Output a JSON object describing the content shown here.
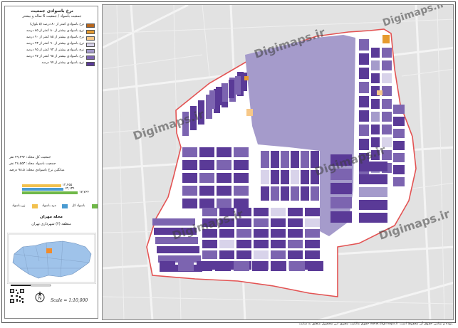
{
  "legend": {
    "title_line1": "نرخ باسوادی جمعیت",
    "title_line2": "جمعیت باسواد / جمعیت 6 ساله و بیشتر",
    "classes": [
      {
        "label": "نرخ باسوادی کمتر از ۸۰ درصد (۵ بلوک)",
        "color": "#b8661c"
      },
      {
        "label": "نرخ باسوادی بیشتر از ۸۰ کمتر از ۸۵ درصد",
        "color": "#e69b30"
      },
      {
        "label": "نرخ باسوادی بیشتر از ۸۵ کمتر از ۹۰ درصد",
        "color": "#f7c888"
      },
      {
        "label": "نرخ باسوادی بیشتر از ۹۰ کمتر از ۹۳ درصد",
        "color": "#d8d3ea"
      },
      {
        "label": "نرخ باسوادی بیشتر از ۹۳ کمتر از ۹۵ درصد",
        "color": "#a59bcb"
      },
      {
        "label": "نرخ باسوادی بیشتر از ۹۵ کمتر از ۹۷ درصد",
        "color": "#7c64b0"
      },
      {
        "label": "نرخ باسوادی بیشتر از ۹۷ درصد",
        "color": "#5a3a97"
      }
    ]
  },
  "stats": {
    "total_population": "جمعیت کل محله: ۲۹,۴۹۲ نفر",
    "literate_population": "جمعیت باسواد محله: ۲۶,۵۵۳ نفر",
    "literacy_rate": "میانگین نرخ باسوادی محله: ۹۸.۵ درصد"
  },
  "bars": [
    {
      "value": "۱۲,۴۵۵",
      "fraction": 0.7,
      "color": "#f2c14e"
    },
    {
      "value": "۱۳,۱۳۴",
      "fraction": 0.74,
      "color": "#4a9bd1"
    },
    {
      "value": "۱۷,۷۶۴",
      "fraction": 1.0,
      "color": "#6fb848"
    }
  ],
  "bar_keys": [
    {
      "label": "زن باسواد",
      "color": "#f2c14e"
    },
    {
      "label": "مرد باسواد",
      "color": "#4a9bd1"
    },
    {
      "label": "باسواد کل",
      "color": "#6fb848"
    }
  ],
  "locator": {
    "title": "محله مهران",
    "subtitle": "منطقه (۴) شهرداری تهران"
  },
  "scale_text": "Scale = 1:10,000",
  "footer_text": "حقوق مالکیت معنوی این محصول متعلق به سایت www.digimaps.ir بوده و تمامی حقوق آن محفوظ است.",
  "watermark": "Digimaps.ir",
  "colors": {
    "background": "#e2e2e2",
    "boundary": "#e35353",
    "park": "#cfcfcf",
    "street": "#ffffff"
  }
}
